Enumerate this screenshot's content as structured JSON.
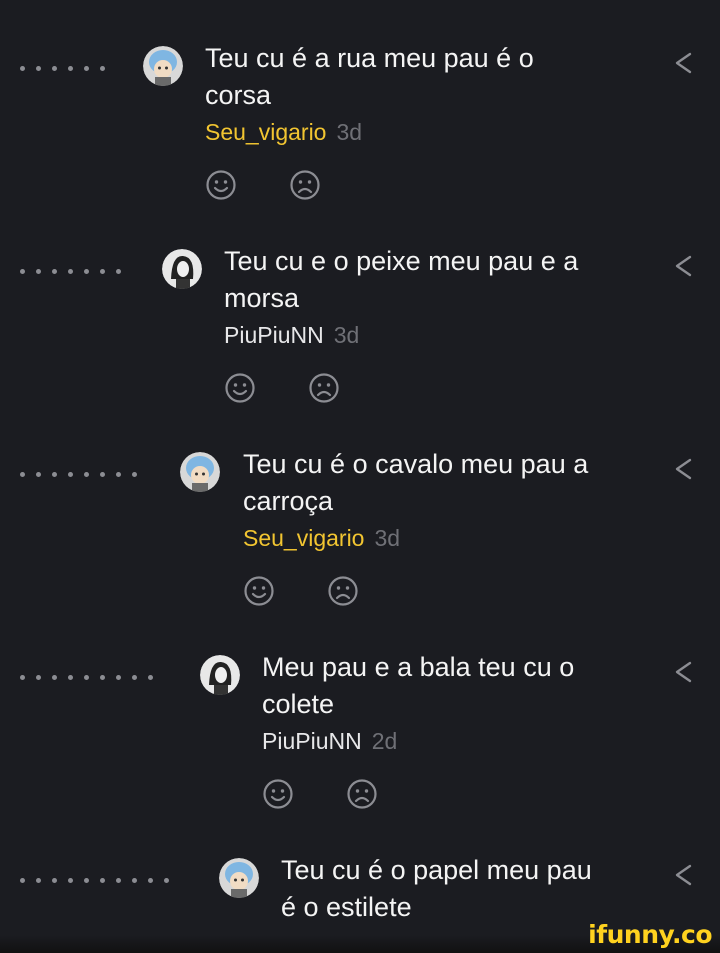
{
  "comments": [
    {
      "text": "Teu cu é a rua meu pau é o corsa",
      "author": "Seu_vigario",
      "time": "3d",
      "avatar": "blue-hair-avatar",
      "author_color": "gold",
      "depth": 6
    },
    {
      "text": "Teu cu e o peixe meu pau e a morsa",
      "author": "PiuPiuNN",
      "time": "3d",
      "avatar": "dark-hair-avatar",
      "author_color": "white",
      "depth": 7
    },
    {
      "text": "Teu cu é o cavalo meu pau a carroça",
      "author": "Seu_vigario",
      "time": "3d",
      "avatar": "blue-hair-avatar",
      "author_color": "gold",
      "depth": 8
    },
    {
      "text": "Meu pau e a bala teu cu o colete",
      "author": "PiuPiuNN",
      "time": "2d",
      "avatar": "dark-hair-avatar",
      "author_color": "white",
      "depth": 9
    },
    {
      "text": "Teu cu é o papel meu pau é o estilete",
      "author": "",
      "time": "",
      "avatar": "blue-hair-avatar",
      "author_color": "gold",
      "depth": 10
    }
  ],
  "icons": {
    "like": "smile-face-icon",
    "dislike": "sad-face-icon",
    "share": "share-chevron-icon"
  },
  "colors": {
    "background": "#1b1c21",
    "author_gold": "#f2c531",
    "watermark": "#ffd21f"
  },
  "watermark": "ifunny.co"
}
